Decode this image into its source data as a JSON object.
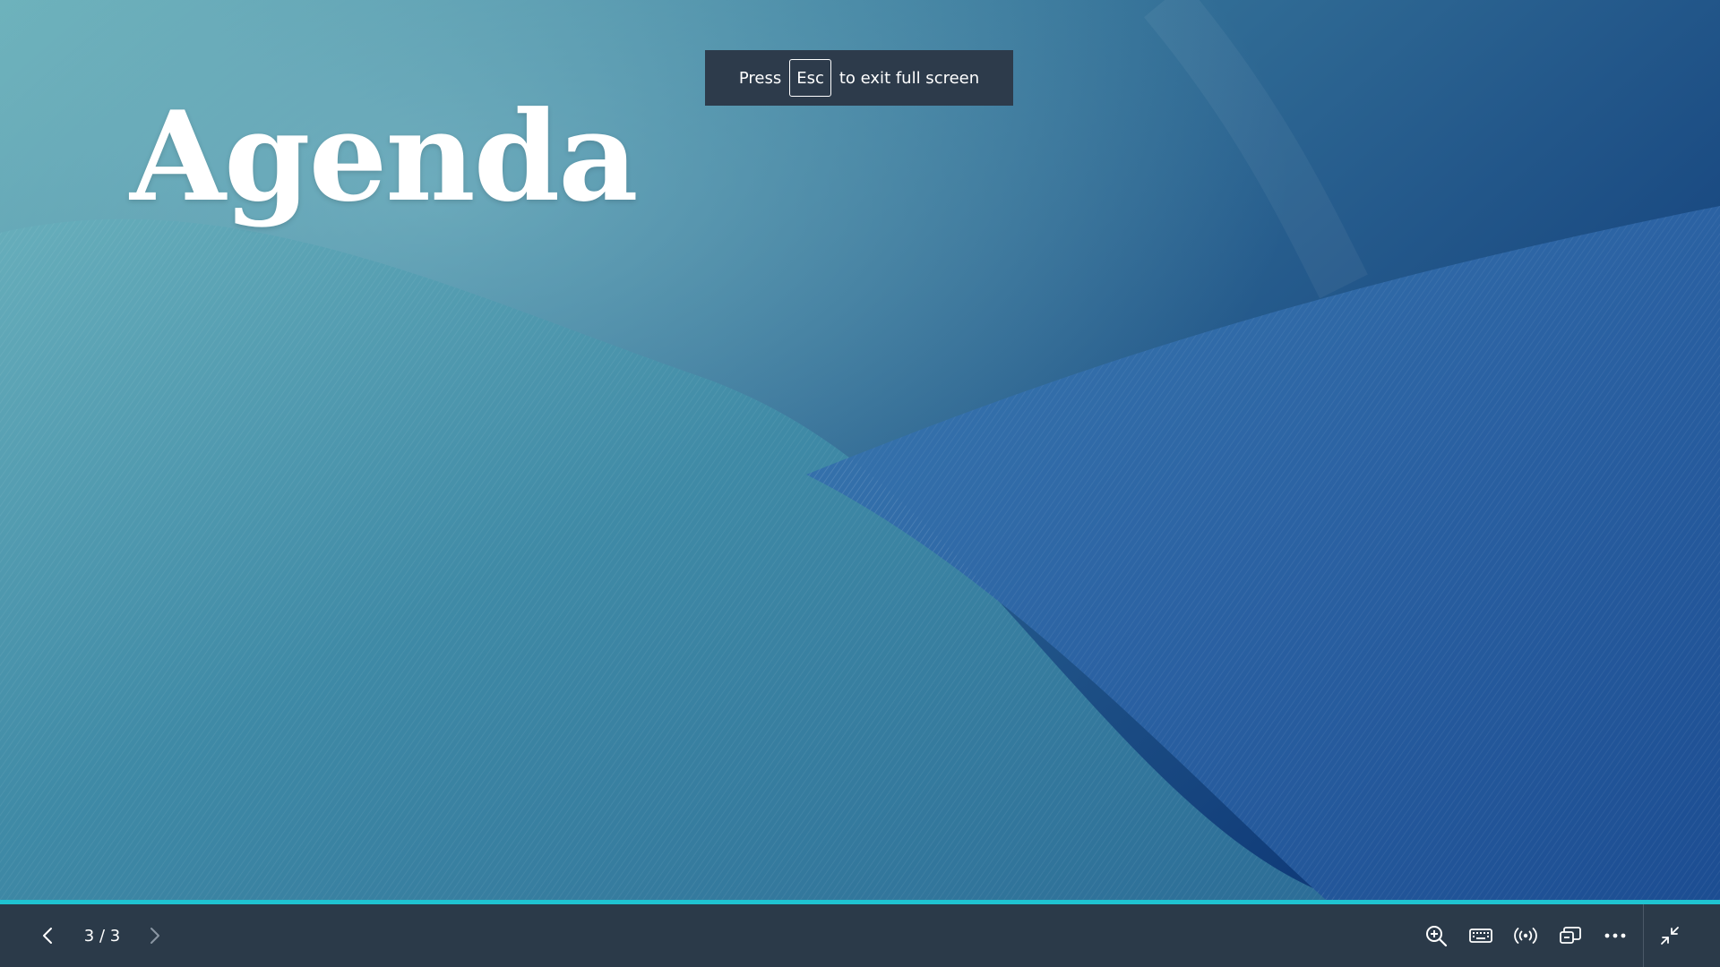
{
  "slide": {
    "title": "Agenda"
  },
  "fullscreen_hint": {
    "prefix": "Press",
    "key": "Esc",
    "suffix": "to exit full screen"
  },
  "progress": {
    "current": 3,
    "total": 3,
    "fraction": 1.0,
    "color": "#1fc3d2"
  },
  "toolbar": {
    "slide_counter": "3 / 3",
    "left_icons": [
      "chevron-left-icon",
      "chevron-right-icon"
    ],
    "right_icons": [
      "zoom-in-icon",
      "keyboard-icon",
      "broadcast-icon",
      "display-settings-icon",
      "more-options-icon",
      "exit-fullscreen-icon"
    ]
  },
  "colors": {
    "toolbar_bg": "#2b3a49",
    "toast_bg": "#2d3b4b",
    "accent": "#1fc3d2"
  }
}
